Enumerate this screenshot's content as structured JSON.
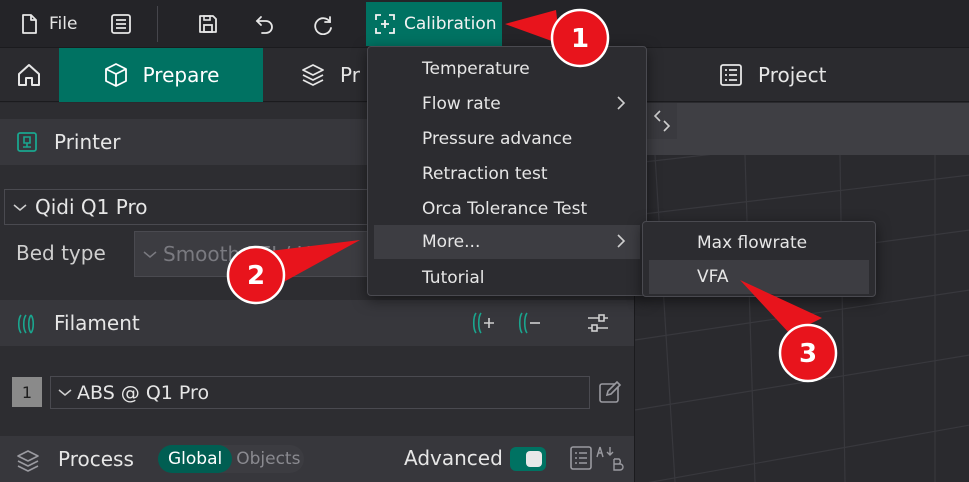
{
  "toolbar": {
    "file_label": "File",
    "calibration_label": "Calibration"
  },
  "tabs": {
    "prepare": "Prepare",
    "preview_partial": "Pr",
    "project": "Project"
  },
  "printer": {
    "section_title": "Printer",
    "selected_printer": "Qidi Q1 Pro",
    "bed_type_label": "Bed type",
    "bed_type_value": "Smooth PEI / H"
  },
  "filament": {
    "section_title": "Filament",
    "slot_number": "1",
    "selected_filament": "ABS @ Q1 Pro"
  },
  "process": {
    "section_title": "Process",
    "global_label": "Global",
    "objects_label": "Objects",
    "advanced_label": "Advanced"
  },
  "calibration_menu": {
    "items": [
      {
        "label": "Temperature"
      },
      {
        "label": "Flow rate"
      },
      {
        "label": "Pressure advance"
      },
      {
        "label": "Retraction test"
      },
      {
        "label": "Orca Tolerance Test"
      },
      {
        "label": "More..."
      },
      {
        "label": "Tutorial"
      }
    ],
    "submenu": [
      {
        "label": "Max flowrate"
      },
      {
        "label": "VFA"
      }
    ]
  },
  "callouts": [
    "1",
    "2",
    "3"
  ],
  "colors": {
    "accent": "#007262",
    "callout": "#e8141c"
  }
}
